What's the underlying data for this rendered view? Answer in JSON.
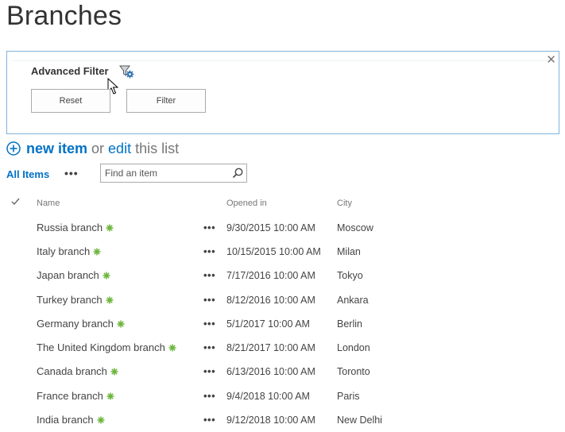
{
  "page": {
    "title": "Branches"
  },
  "filter": {
    "title": "Advanced Filter",
    "reset_label": "Reset",
    "filter_label": "Filter",
    "close_label": "✕"
  },
  "toolbar": {
    "new_item": "new item",
    "or": "or",
    "edit": "edit",
    "this_list": "this list"
  },
  "views": {
    "current": "All Items",
    "more": "•••"
  },
  "search": {
    "placeholder": "Find an item"
  },
  "columns": {
    "name": "Name",
    "opened": "Opened in",
    "city": "City"
  },
  "rows": [
    {
      "name": "Russia branch",
      "opened": "9/30/2015 10:00 AM",
      "city": "Moscow"
    },
    {
      "name": "Italy branch",
      "opened": "10/15/2015 10:00 AM",
      "city": "Milan"
    },
    {
      "name": "Japan branch",
      "opened": "7/17/2016 10:00 AM",
      "city": "Tokyo"
    },
    {
      "name": "Turkey branch",
      "opened": "8/12/2016 10:00 AM",
      "city": "Ankara"
    },
    {
      "name": "Germany branch",
      "opened": "5/1/2017 10:00 AM",
      "city": "Berlin"
    },
    {
      "name": "The United Kingdom branch",
      "opened": "8/21/2017 10:00 AM",
      "city": "London"
    },
    {
      "name": "Canada branch",
      "opened": "6/13/2016 10:00 AM",
      "city": "Toronto"
    },
    {
      "name": "France branch",
      "opened": "9/4/2018 10:00 AM",
      "city": "Paris"
    },
    {
      "name": "India branch",
      "opened": "9/12/2018 10:00 AM",
      "city": "New Delhi"
    }
  ],
  "row_menu": "•••",
  "colors": {
    "accent": "#0072c6",
    "panel_border": "#7eb3de",
    "new_badge": "#6bb53a"
  }
}
